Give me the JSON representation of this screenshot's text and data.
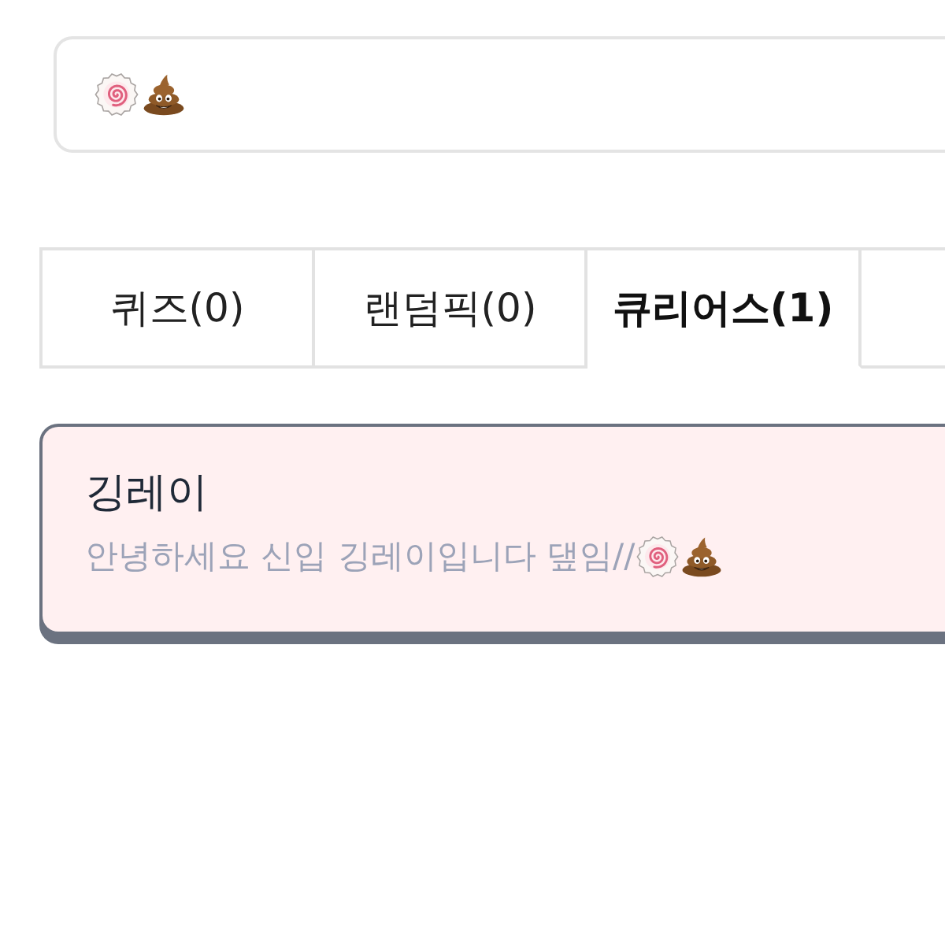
{
  "tabs": [
    {
      "label": "퀴즈(0)",
      "selected": false
    },
    {
      "label": "랜덤픽(0)",
      "selected": false
    },
    {
      "label": "큐리어스(1)",
      "selected": true
    },
    {
      "selected": false
    }
  ],
  "posts": [
    {
      "author": "깅레이",
      "message": "안녕하세요 신입 깅레이입니다 댚임//"
    }
  ]
}
